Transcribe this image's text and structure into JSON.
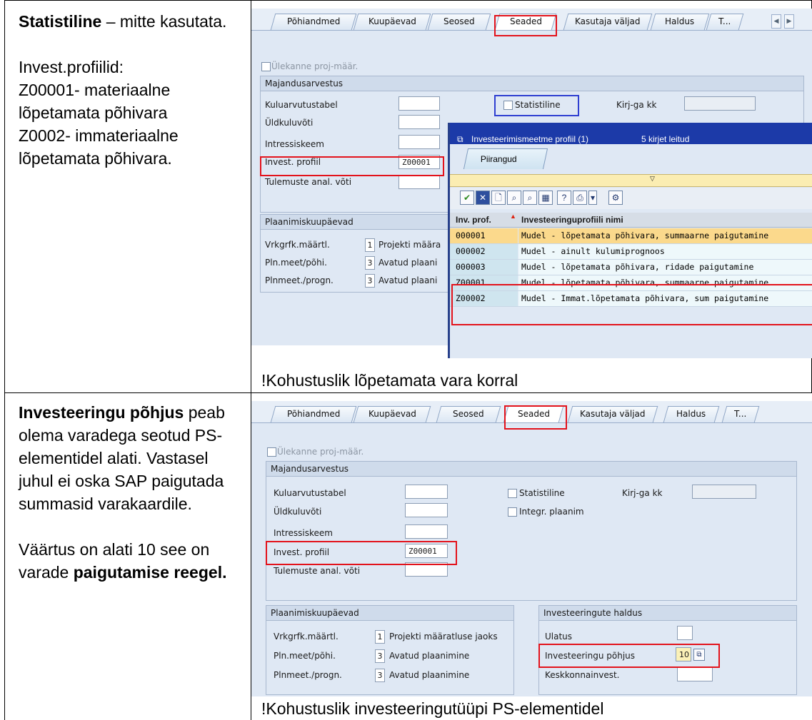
{
  "left_top": {
    "title_bold": "Statistiline",
    "title_rest": " – mitte kasutata.",
    "line1": "Invest.profiilid:",
    "line2": "Z00001- materiaalne lõpetamata põhivara",
    "line3": "Z0002- immateriaalne lõpetamata põhivara."
  },
  "left_bottom": {
    "bold": "Investeeringu põhjus",
    "rest": " peab olema varadega seotud PS-elementidel alati. Vastasel juhul ei oska SAP paigutada summasid varakaardile.",
    "p2_start": "Väärtus on alati 10 see on varade ",
    "p2_bold": "paigutamise reegel."
  },
  "notes": {
    "top": "!Kohustuslik lõpetamata vara korral",
    "bottom": "!Kohustuslik investeeringutüüpi PS-elementidel"
  },
  "screen1": {
    "tabs": [
      "Põhiandmed",
      "Kuupäevad",
      "Seosed",
      "Seaded",
      "Kasutaja väljad",
      "Haldus",
      "T..."
    ],
    "checkbox_label": "Ülekanne proj-määr.",
    "group1_title": "Majandusarvestus",
    "fields": [
      "Kuluarvutustabel",
      "Üldkuluvõti",
      "Intressiskeem",
      "Invest. profiil",
      "Tulemuste anal. võti"
    ],
    "profile_value": "Z00001",
    "statistiline": "Statistiline",
    "kirjga": "Kirj-ga kk",
    "group2_title": "Plaanimiskuupäevad",
    "plan_labels": [
      "Vrkgrfk.määrtl.",
      "Pln.meet/põhi.",
      "Plnmeet./progn."
    ],
    "plan_nums": [
      "1",
      "3",
      "3"
    ],
    "plan_texts": [
      "Projekti määra",
      "Avatud plaani",
      "Avatud plaani"
    ]
  },
  "popup": {
    "title": "Investeerimismeetme profiil (1)",
    "found": "5 kirjet leitud",
    "tab": "Piirangud",
    "col1": "Inv. prof.",
    "col2": "Investeeringuprofiili nimi",
    "rows": [
      {
        "code": "000001",
        "name": "Mudel - lõpetamata põhivara, summaarne paigutamine"
      },
      {
        "code": "000002",
        "name": "Mudel - ainult kulumiprognoos"
      },
      {
        "code": "000003",
        "name": "Mudel - lõpetamata põhivara, ridade paigutamine"
      },
      {
        "code": "Z00001",
        "name": "Mudel - lõpetamata põhivara, summaarne paigutamine"
      },
      {
        "code": "Z00002",
        "name": "Mudel - Immat.lõpetamata põhivara, sum paigutamine"
      }
    ]
  },
  "screen2": {
    "tabs": [
      "Põhiandmed",
      "Kuupäevad",
      "Seosed",
      "Seaded",
      "Kasutaja väljad",
      "Haldus",
      "T..."
    ],
    "checkbox_label": "Ülekanne proj-määr.",
    "group1_title": "Majandusarvestus",
    "fields": [
      "Kuluarvutustabel",
      "Üldkuluvõti",
      "Intressiskeem",
      "Invest. profiil",
      "Tulemuste anal. võti"
    ],
    "profile_value": "Z00001",
    "statistiline": "Statistiline",
    "integr": "Integr. plaanim",
    "kirjga": "Kirj-ga kk",
    "group2_title": "Plaanimiskuupäevad",
    "plan_labels": [
      "Vrkgrfk.määrtl.",
      "Pln.meet/põhi.",
      "Plnmeet./progn."
    ],
    "plan_nums": [
      "1",
      "3",
      "3"
    ],
    "plan_texts": [
      "Projekti määratluse jaoks",
      "Avatud plaanimine",
      "Avatud plaanimine"
    ],
    "group3_title": "Investeeringute haldus",
    "inv_labels": [
      "Ulatus",
      "Investeeringu põhjus",
      "Keskkonnainvest."
    ],
    "reason_value": "10"
  },
  "colors": {
    "highlight_red": "#e3121b",
    "highlight_blue": "#2f3fd1",
    "sap_bg": "#dfe8f4"
  }
}
